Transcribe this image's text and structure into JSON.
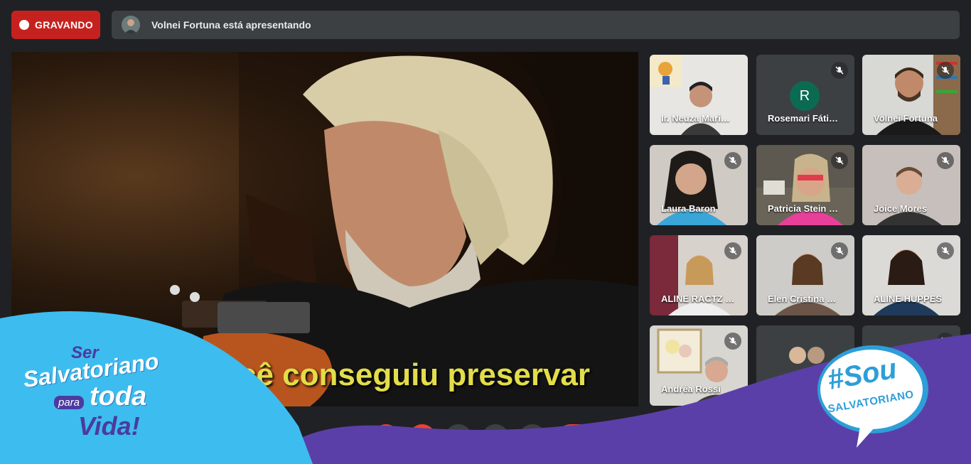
{
  "recording": {
    "label": "GRAVANDO"
  },
  "presenter": {
    "text": "Volnei Fortuna está apresentando"
  },
  "main_video": {
    "subtitle": "cê conseguiu preservar"
  },
  "participants": [
    {
      "name": "Ir. Neuza Mari…",
      "muted": false
    },
    {
      "name": "Rosemari Fáti…",
      "muted": true,
      "initial": "R"
    },
    {
      "name": "Volnei Fortuna",
      "muted": true
    },
    {
      "name": "Laura Baron",
      "muted": true
    },
    {
      "name": "Patricia Stein …",
      "muted": true
    },
    {
      "name": "Joice Mores",
      "muted": true
    },
    {
      "name": "ALINE RACTZ …",
      "muted": true
    },
    {
      "name": "Elen Cristina …",
      "muted": true
    },
    {
      "name": "ALINE HUPPES",
      "muted": true
    },
    {
      "name": "Andréa Rossi",
      "muted": true
    }
  ],
  "branding": {
    "left_line1": "Ser",
    "left_line2": "Salvatoriano",
    "left_para": "para",
    "left_toda": "toda",
    "left_vida": "Vida!",
    "right_hashtag": "#Sou",
    "right_word": "SALVATORIANO"
  },
  "colors": {
    "record": "#c5221f",
    "banner_blue": "#3dbcef",
    "banner_purple": "#5b3fa8",
    "subtitle": "#e2dd4a"
  }
}
